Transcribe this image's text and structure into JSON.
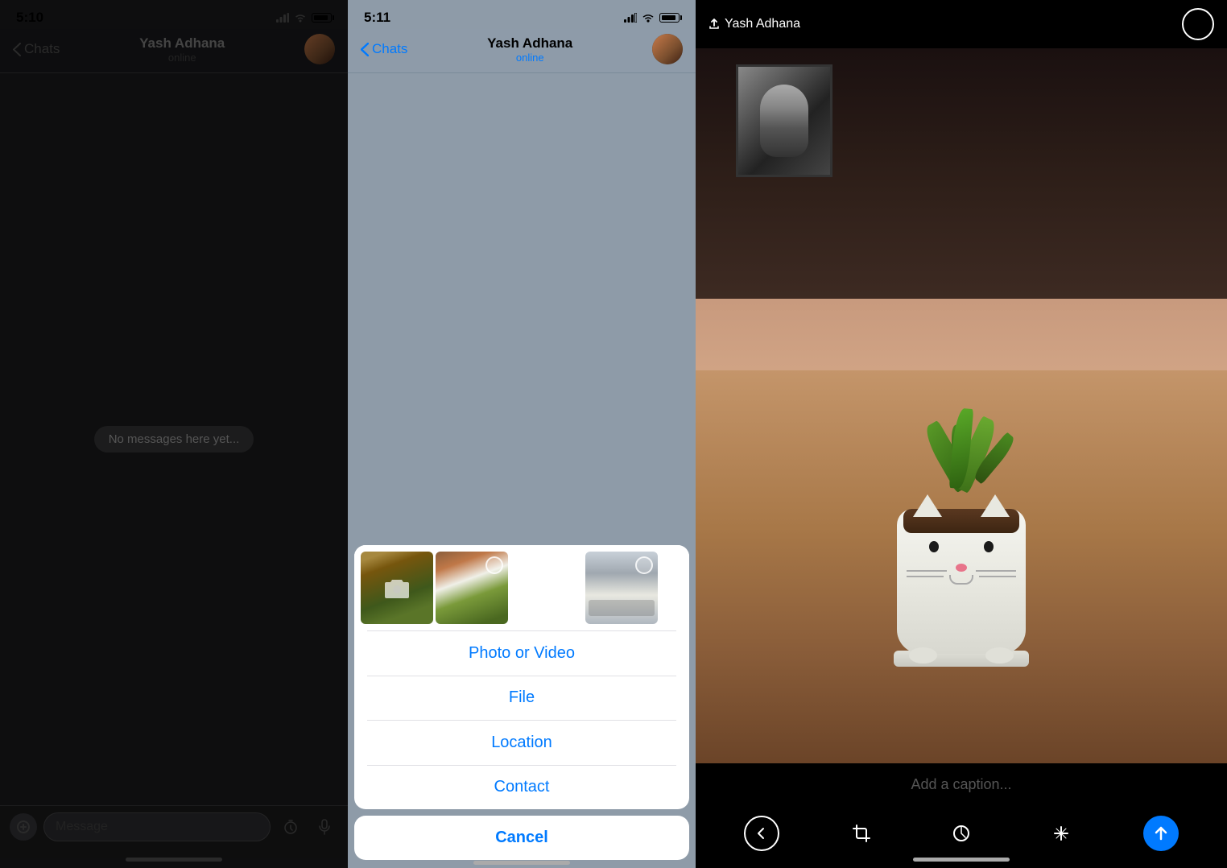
{
  "panel1": {
    "status_time": "5:10",
    "nav_back": "Chats",
    "nav_title": "Yash Adhana",
    "nav_subtitle": "online",
    "no_messages": "No messages here yet...",
    "input_placeholder": "Message"
  },
  "panel2": {
    "status_time": "5:11",
    "nav_back": "Chats",
    "nav_title": "Yash Adhana",
    "nav_subtitle": "online",
    "action_sheet": {
      "item1": "Photo or Video",
      "item2": "File",
      "item3": "Location",
      "item4": "Contact",
      "cancel": "Cancel"
    }
  },
  "panel3": {
    "recipient": "Yash Adhana",
    "caption_placeholder": "Add a caption..."
  }
}
